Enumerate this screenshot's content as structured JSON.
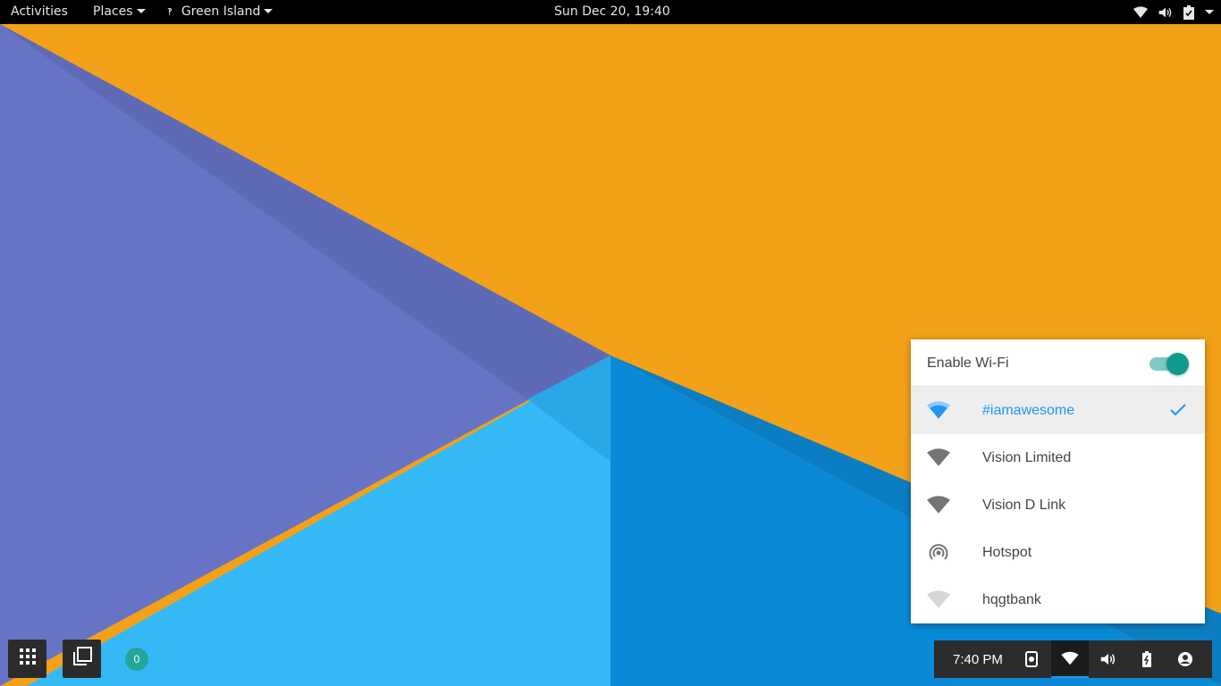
{
  "topbar": {
    "activities": "Activities",
    "places": "Places",
    "app_name": "Green Island",
    "clock": "Sun Dec 20, 19:40",
    "icons": [
      "wifi-icon",
      "volume-icon",
      "battery-icon",
      "chevron-down-icon"
    ]
  },
  "wallpaper": {
    "colors": {
      "orange": "#f2a119",
      "purple": "#6773c5",
      "dark_purple": "#5f6ab6",
      "light_blue": "#35b9f6",
      "blue": "#0a8ad6",
      "dark_blue": "#0b7ec3"
    }
  },
  "wifi_popup": {
    "enable_label": "Enable Wi-Fi",
    "enabled": true,
    "accent": "#2196f3",
    "toggle_color": "#0e9c8c",
    "networks": [
      {
        "name": "#iamawesome",
        "icon": "wifi-icon",
        "connected": true
      },
      {
        "name": "Vision Limited",
        "icon": "wifi-icon",
        "connected": false
      },
      {
        "name": "Vision D Link",
        "icon": "wifi-icon",
        "connected": false
      },
      {
        "name": "Hotspot",
        "icon": "hotspot-icon",
        "connected": false
      },
      {
        "name": "hqgtbank",
        "icon": "wifi-icon",
        "connected": false
      }
    ]
  },
  "shell": {
    "badge_count": "0",
    "tray_time": "7:40 PM",
    "tray_icons": [
      "screenshot-icon",
      "wifi-icon",
      "volume-icon",
      "battery-icon",
      "user-icon"
    ]
  }
}
